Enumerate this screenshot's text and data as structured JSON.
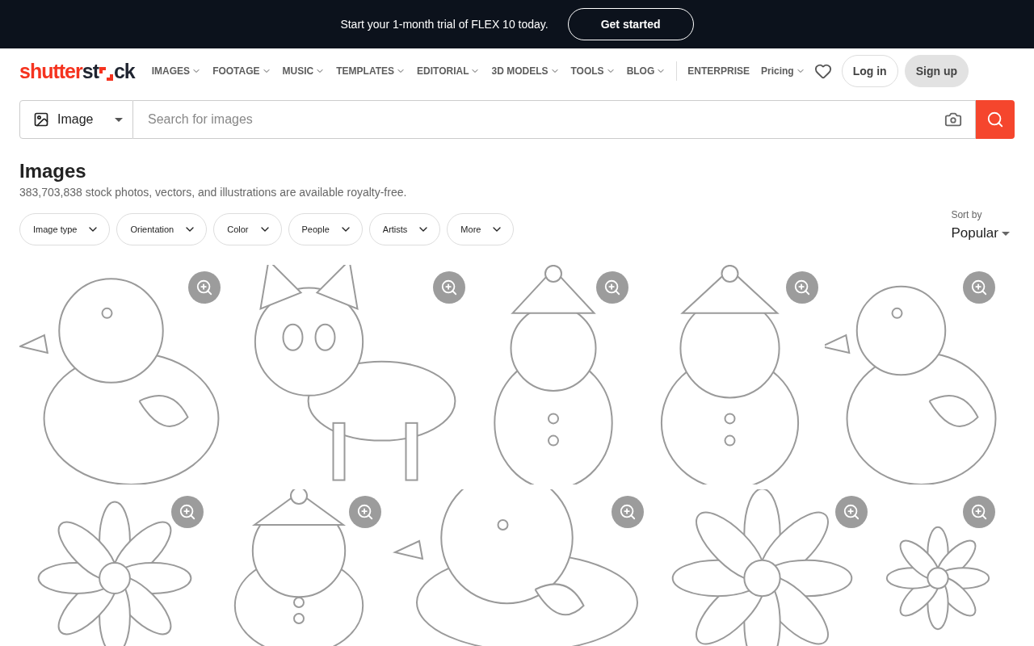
{
  "promo_banner": {
    "text": "Start your 1-month trial of FLEX 10 today.",
    "button": "Get started"
  },
  "header": {
    "logo": {
      "part_1": "shutter",
      "part_2": "st",
      "part_3": "ck"
    },
    "nav": [
      {
        "label": "IMAGES",
        "dropdown": true
      },
      {
        "label": "FOOTAGE",
        "dropdown": true
      },
      {
        "label": "MUSIC",
        "dropdown": true
      },
      {
        "label": "TEMPLATES",
        "dropdown": true
      },
      {
        "label": "EDITORIAL",
        "dropdown": true
      },
      {
        "label": "3D MODELS",
        "dropdown": true
      },
      {
        "label": "TOOLS",
        "dropdown": true
      },
      {
        "label": "BLOG",
        "dropdown": true
      },
      {
        "label": "ENTERPRISE",
        "dropdown": false
      },
      {
        "label": "Pricing",
        "dropdown": true
      }
    ],
    "login": "Log in",
    "signup": "Sign up"
  },
  "search": {
    "type": "Image",
    "placeholder": "Search for images"
  },
  "heading": "Images",
  "subheading": "383,703,838 stock photos, vectors, and illustrations are available royalty-free.",
  "filters": [
    "Image type",
    "Orientation",
    "Color",
    "People",
    "Artists",
    "More"
  ],
  "sort": {
    "label": "Sort by",
    "value": "Popular"
  }
}
